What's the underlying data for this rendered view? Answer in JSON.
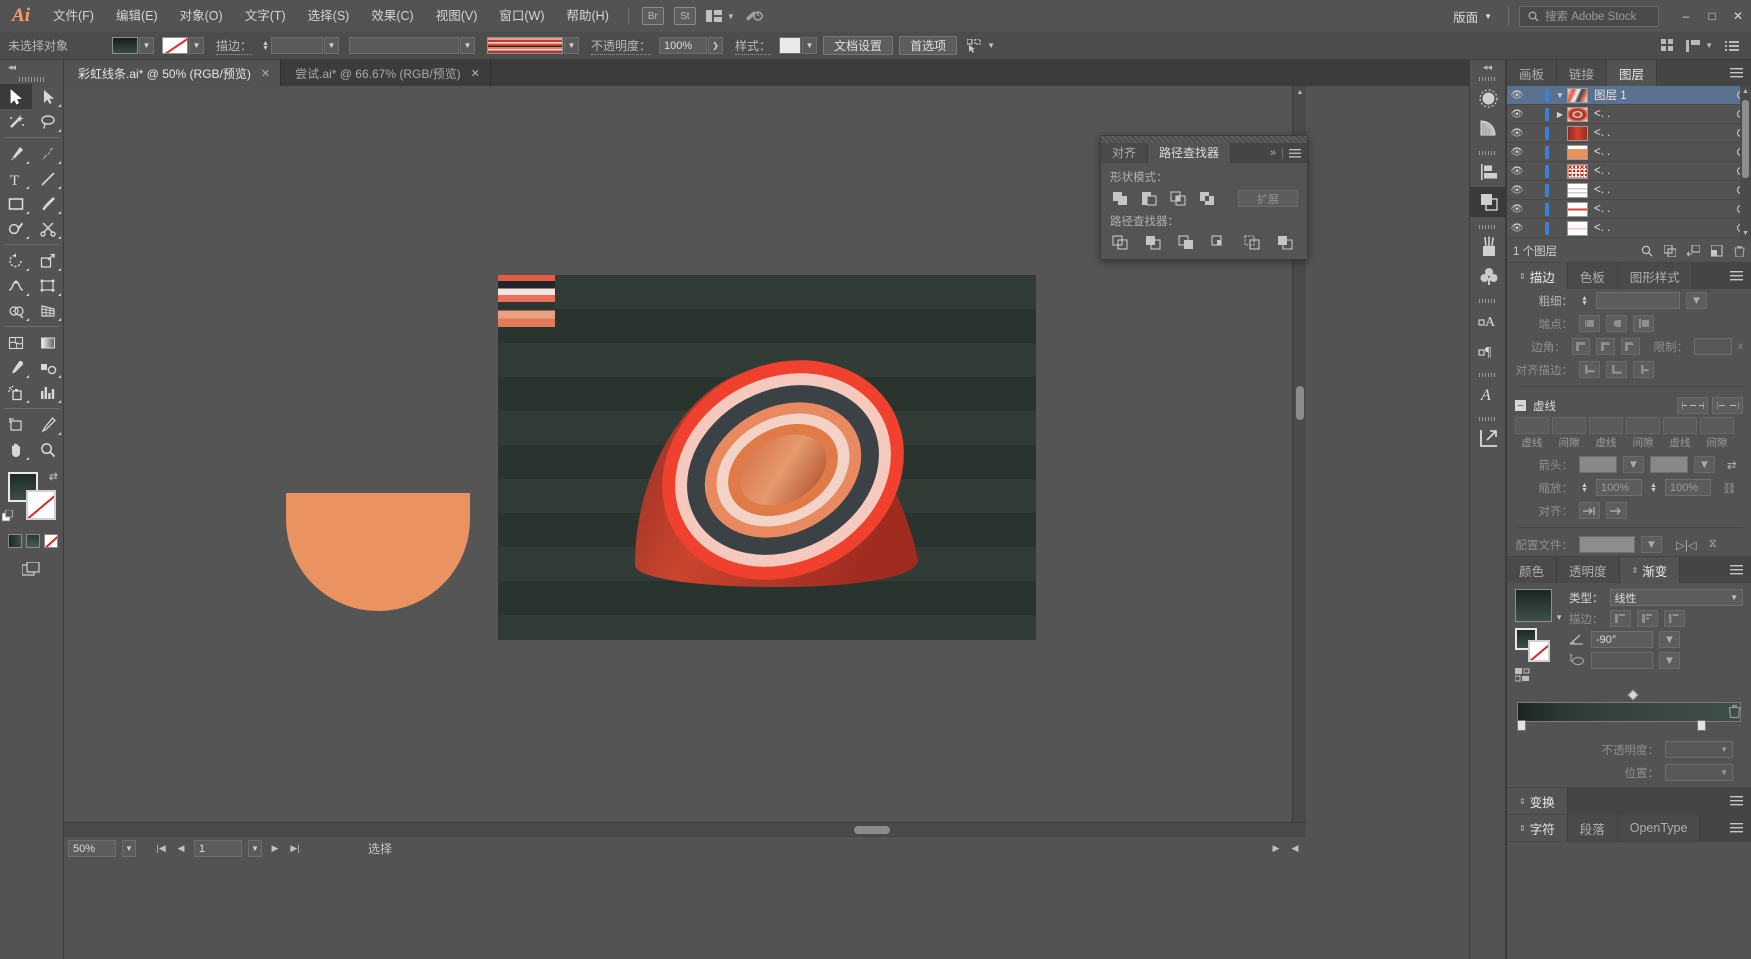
{
  "app": {
    "name": "Ai",
    "logo": "Ai"
  },
  "menubar": {
    "items": [
      "文件(F)",
      "编辑(E)",
      "对象(O)",
      "文字(T)",
      "选择(S)",
      "效果(C)",
      "视图(V)",
      "窗口(W)",
      "帮助(H)"
    ],
    "bridge": "Br",
    "stock": "St",
    "layout_label": "版面",
    "search_placeholder": "搜索 Adobe Stock",
    "minimize": "–",
    "maximize": "□",
    "close": "✕"
  },
  "controlbar": {
    "selection_status": "未选择对象",
    "stroke_label": "描边：",
    "opacity_label": "不透明度：",
    "opacity_value": "100%",
    "style_label": "样式：",
    "doc_setup": "文档设置",
    "preferences": "首选项",
    "align_icon": "align-objects-icon",
    "arrange_grid_icon": "arrange-grid-icon",
    "arrange_doc_icon": "arrange-documents-icon",
    "list_icon": "panel-list-icon"
  },
  "tabs": [
    {
      "title": "彩虹线条.ai* @ 50% (RGB/预览)",
      "active": true,
      "close": "✕"
    },
    {
      "title": "尝试.ai* @ 66.67% (RGB/预览)",
      "active": false,
      "close": "✕"
    }
  ],
  "toolbar": {
    "collapse": "◂◂",
    "tools": [
      "selection-tool",
      "direct-selection-tool",
      "magic-wand-tool",
      "lasso-tool",
      "pen-tool",
      "curvature-tool",
      "type-tool",
      "line-segment-tool",
      "rectangle-tool",
      "paintbrush-tool",
      "shaper-tool",
      "scissors-tool",
      "rotate-tool",
      "scale-tool",
      "width-tool",
      "free-transform-tool",
      "shape-builder-tool",
      "perspective-grid-tool",
      "mesh-tool",
      "gradient-tool",
      "eyedropper-tool",
      "blend-tool",
      "symbol-sprayer-tool",
      "column-graph-tool",
      "artboard-tool",
      "slice-tool",
      "hand-tool",
      "zoom-tool"
    ]
  },
  "canvas": {
    "artboard_background": "#2b3631",
    "half_circle_color": "#ea9361",
    "rainbow_strip": "rainbow-stripe-swatch"
  },
  "statusbar": {
    "zoom": "50%",
    "page": "1",
    "tool_status": "选择",
    "first_icon": "first-page-icon",
    "prev_icon": "prev-page-icon",
    "next_icon": "next-page-icon",
    "last_icon": "last-page-icon"
  },
  "pathfinder": {
    "tabs": [
      {
        "label": "对齐",
        "active": false
      },
      {
        "label": "路径查找器",
        "active": true
      }
    ],
    "shape_modes_label": "形状模式：",
    "shape_modes": [
      "unite-icon",
      "minus-front-icon",
      "intersect-icon",
      "exclude-icon"
    ],
    "expand_button": "扩展",
    "pathfinders_label": "路径查找器：",
    "pathfinders": [
      "divide-icon",
      "trim-icon",
      "merge-icon",
      "crop-icon",
      "outline-icon",
      "minus-back-icon"
    ],
    "collapse_icon": "double-chevron-right-icon",
    "menu_icon": "panel-menu-icon"
  },
  "dockrail": {
    "collapse": "◂◂",
    "buttons": [
      "brushes-panel-icon",
      "symbols-panel-icon",
      "align-panel-icon",
      "pathfinder-panel-icon",
      "brush-libraries-icon",
      "symbol-libraries-icon",
      "character-styles-icon",
      "paragraph-styles-icon",
      "glyphs-panel-icon",
      "asset-export-icon"
    ]
  },
  "layers_panel": {
    "tabs": [
      {
        "label": "画板",
        "active": false
      },
      {
        "label": "链接",
        "active": false
      },
      {
        "label": "图层",
        "active": true
      }
    ],
    "menu_icon": "panel-menu-icon",
    "rows": [
      {
        "name": "图层 1",
        "selected": true,
        "thumb": "layer-group-thumb",
        "eye": "visible",
        "twirl": "open"
      },
      {
        "name": "<. .",
        "selected": false,
        "thumb": "red-ring-thumb",
        "eye": "visible",
        "twirl": "closed"
      },
      {
        "name": "<. .",
        "selected": false,
        "thumb": "red-dome-thumb",
        "eye": "visible",
        "twirl": "none"
      },
      {
        "name": "<. .",
        "selected": false,
        "thumb": "orange-dome-thumb",
        "eye": "visible",
        "twirl": "none"
      },
      {
        "name": "<. .",
        "selected": false,
        "thumb": "speckled-thumb",
        "eye": "visible",
        "twirl": "none"
      },
      {
        "name": "<. .",
        "selected": false,
        "thumb": "white-lines-thumb",
        "eye": "visible",
        "twirl": "none"
      },
      {
        "name": "<. .",
        "selected": false,
        "thumb": "red-line-thumb",
        "eye": "visible",
        "twirl": "none"
      },
      {
        "name": "<. .",
        "selected": false,
        "thumb": "pink-line-thumb",
        "eye": "visible",
        "twirl": "none"
      }
    ],
    "footer_count": "1 个图层",
    "footer_icons": [
      "locate-object-icon",
      "make-sublayer-icon",
      "release-to-layers-icon",
      "new-layer-icon",
      "delete-layer-icon"
    ]
  },
  "stroke_panel": {
    "tabs": [
      {
        "label": "描边",
        "active": true
      },
      {
        "label": "色板",
        "active": false
      },
      {
        "label": "图形样式",
        "active": false
      }
    ],
    "menu_icon": "panel-menu-icon",
    "weight_label": "粗细：",
    "weight_value": "",
    "cap_label": "端点：",
    "corner_label": "边角：",
    "limit_label": "限制：",
    "limit_unit": "x",
    "align_label": "对齐描边：",
    "dash_label": "虚线",
    "dash_fields": [
      "虚线",
      "间隙",
      "虚线",
      "间隙",
      "虚线",
      "间隙"
    ],
    "arrow_label": "箭头：",
    "scale_label": "缩放：",
    "scale_value_1": "100%",
    "scale_value_2": "100%",
    "align_arrow_label": "对齐：",
    "profile_label": "配置文件："
  },
  "gradient_panel": {
    "tabs": [
      {
        "label": "颜色",
        "active": false
      },
      {
        "label": "透明度",
        "active": false
      },
      {
        "label": "渐变",
        "active": true
      }
    ],
    "menu_icon": "panel-menu-icon",
    "type_label": "类型：",
    "type_value": "线性",
    "stroke_label": "描边：",
    "angle_label": "gradient-angle-icon",
    "angle_value": "-90°",
    "aspect_label": "gradient-aspect-icon",
    "opacity_label": "不透明度：",
    "position_label": "位置：",
    "gradient_colors": [
      "#1a251f",
      "#3e5048"
    ],
    "delete_icon": "trash-icon"
  },
  "transform_panel": {
    "tabs": [
      {
        "label": "变换",
        "active": true
      }
    ],
    "menu_icon": "panel-menu-icon"
  },
  "character_panel": {
    "tabs": [
      {
        "label": "字符",
        "active": true
      },
      {
        "label": "段落",
        "active": false
      },
      {
        "label": "OpenType",
        "active": false
      }
    ],
    "menu_icon": "panel-menu-icon"
  }
}
